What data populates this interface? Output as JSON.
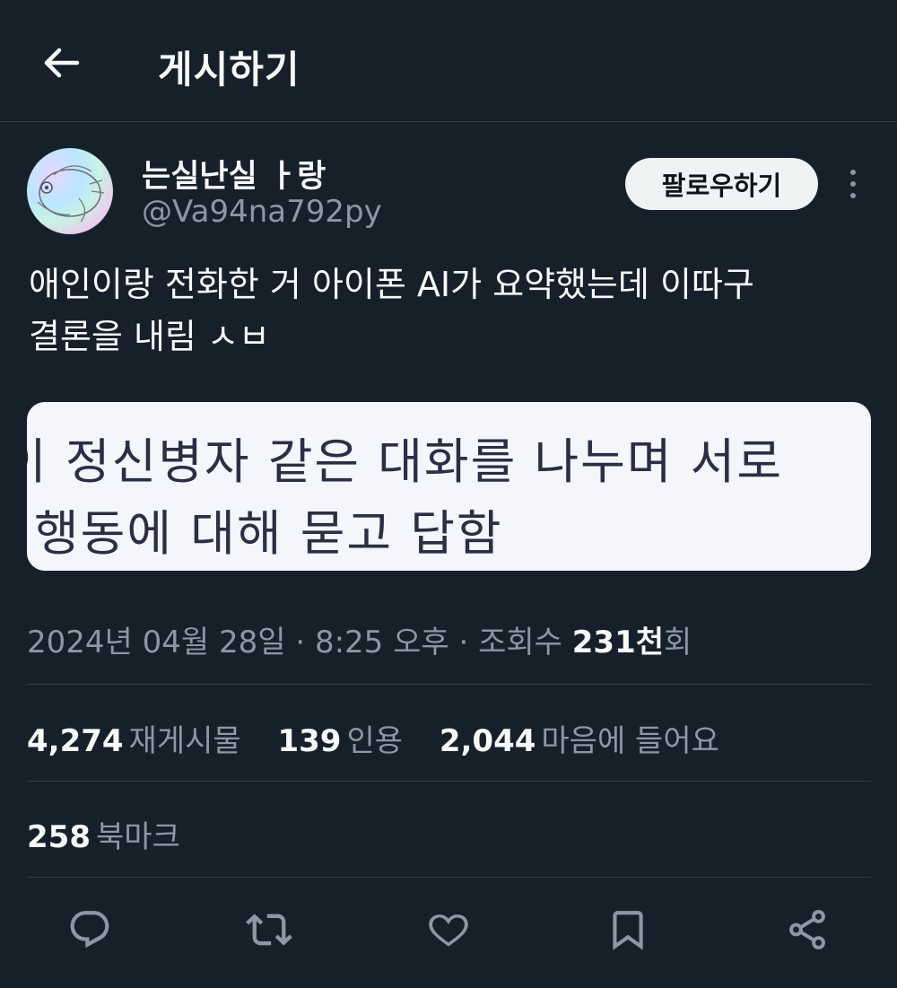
{
  "header": {
    "title": "게시하기"
  },
  "author": {
    "display_name": "는실난실 ㅏ랑",
    "handle": "@Va94na792py",
    "follow_label": "팔로우하기"
  },
  "tweet": {
    "text": "애인이랑 전화한 거 아이폰 AI가 요약했는데 이따구\n결론을 내림 ㅅㅂ",
    "media_text": {
      "line1": "이 정신병자 같은 대화를 나누며 서로",
      "line2": "행동에 대해 묻고 답함"
    }
  },
  "meta": {
    "date": "2024년 04월 28일",
    "time": "8:25 오후",
    "views_label": "조회수",
    "views_value": "231천",
    "views_suffix": "회",
    "separator": "·"
  },
  "stats": {
    "retweets": {
      "value": "4,274",
      "label": "재게시물"
    },
    "quotes": {
      "value": "139",
      "label": "인용"
    },
    "likes": {
      "value": "2,044",
      "label": "마음에 들어요"
    },
    "bookmarks": {
      "value": "258",
      "label": "북마크"
    }
  },
  "actions": [
    "reply-icon",
    "retweet-icon",
    "like-icon",
    "bookmark-icon",
    "share-icon"
  ],
  "colors": {
    "background": "#15202b",
    "text": "#f7f9f9",
    "muted": "#8b98a5",
    "divider": "#2f3d4b",
    "follow_button_bg": "#eff3f4"
  }
}
